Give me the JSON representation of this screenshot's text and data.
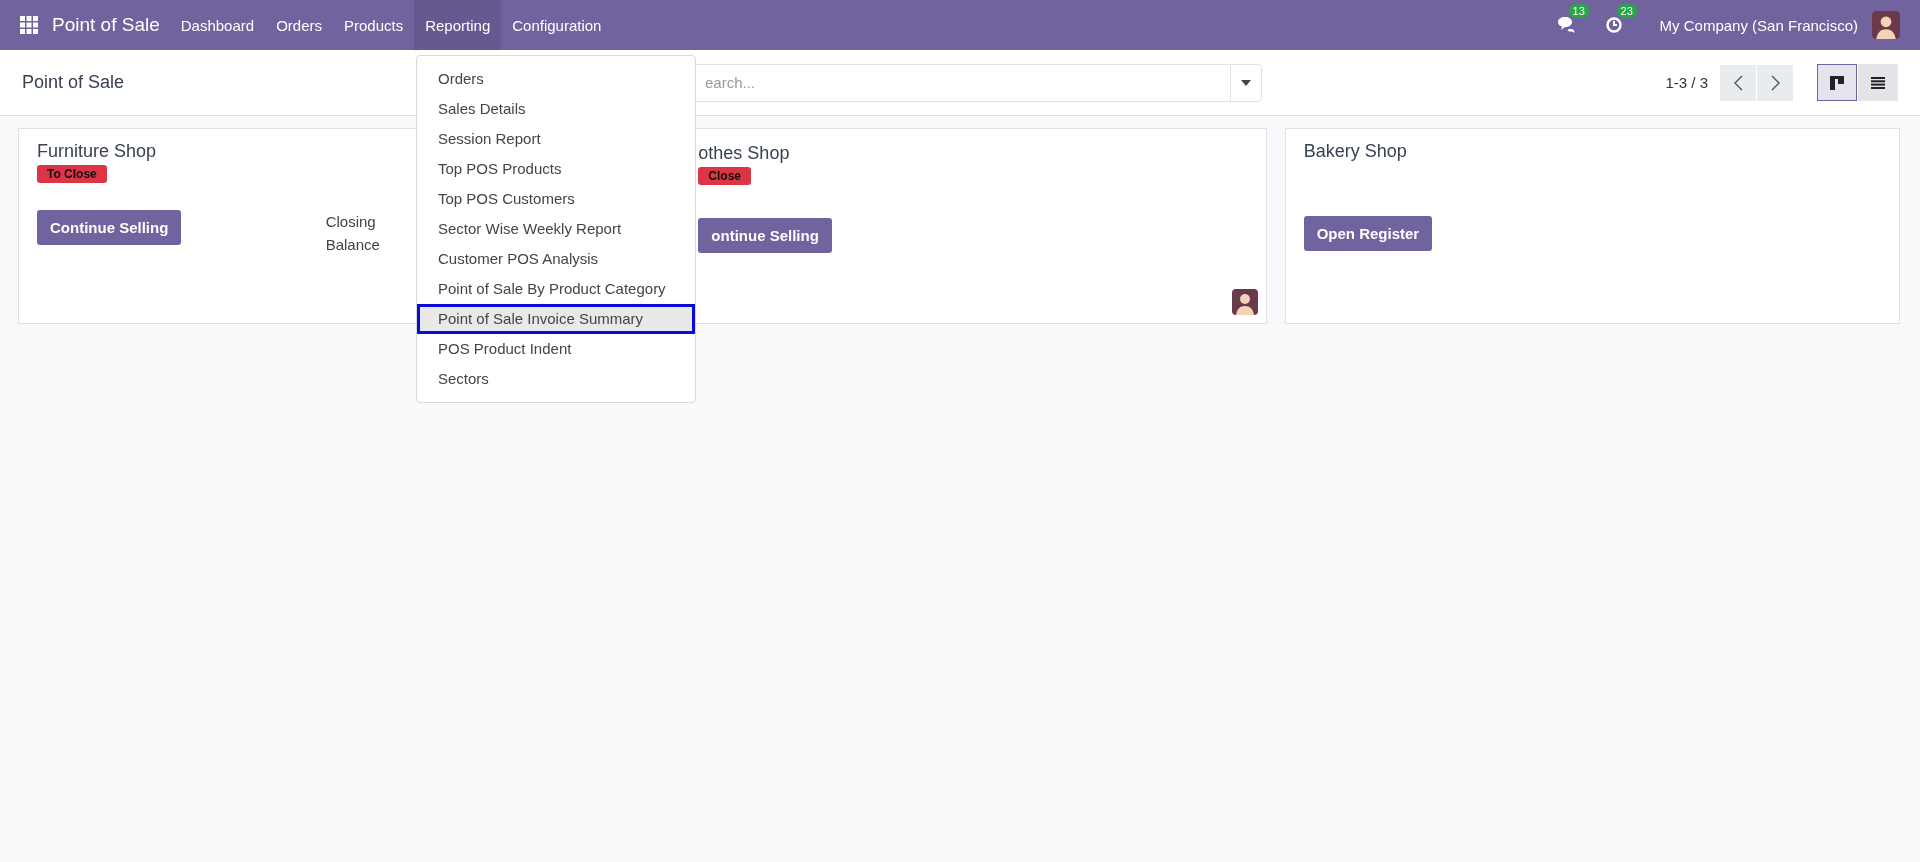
{
  "navbar": {
    "app_name": "Point of Sale",
    "menus": [
      {
        "label": "Dashboard",
        "selected": false
      },
      {
        "label": "Orders",
        "selected": false
      },
      {
        "label": "Products",
        "selected": false
      },
      {
        "label": "Reporting",
        "selected": true
      },
      {
        "label": "Configuration",
        "selected": false
      }
    ],
    "messages_count": "13",
    "activities_count": "23",
    "company": "My Company (San Francisco)"
  },
  "dropdown": {
    "items": [
      {
        "label": "Orders",
        "selected": false
      },
      {
        "label": "Sales Details",
        "selected": false
      },
      {
        "label": "Session Report",
        "selected": false
      },
      {
        "label": "Top POS Products",
        "selected": false
      },
      {
        "label": "Top POS Customers",
        "selected": false
      },
      {
        "label": "Sector Wise Weekly Report",
        "selected": false
      },
      {
        "label": "Customer POS Analysis",
        "selected": false
      },
      {
        "label": "Point of Sale By Product Category",
        "selected": false
      },
      {
        "label": "Point of Sale Invoice Summary",
        "selected": true
      },
      {
        "label": "POS Product Indent",
        "selected": false
      },
      {
        "label": "Sectors",
        "selected": false
      }
    ]
  },
  "control_panel": {
    "breadcrumb": "Point of Sale",
    "search": {
      "placeholder": "earch..."
    },
    "pager": "1-3 / 3",
    "views": [
      {
        "kind": "kanban",
        "selected": true
      },
      {
        "kind": "list",
        "selected": false
      }
    ]
  },
  "cards": [
    {
      "name": "Furniture Shop",
      "badge": "To Close",
      "button": "Continue Selling",
      "closing_label": "Closing Balance"
    },
    {
      "name": "othes Shop",
      "badge": "Close",
      "button": "ontinue Selling",
      "avatar": true
    },
    {
      "name": "Bakery Shop",
      "button": "Open Register"
    }
  ]
}
